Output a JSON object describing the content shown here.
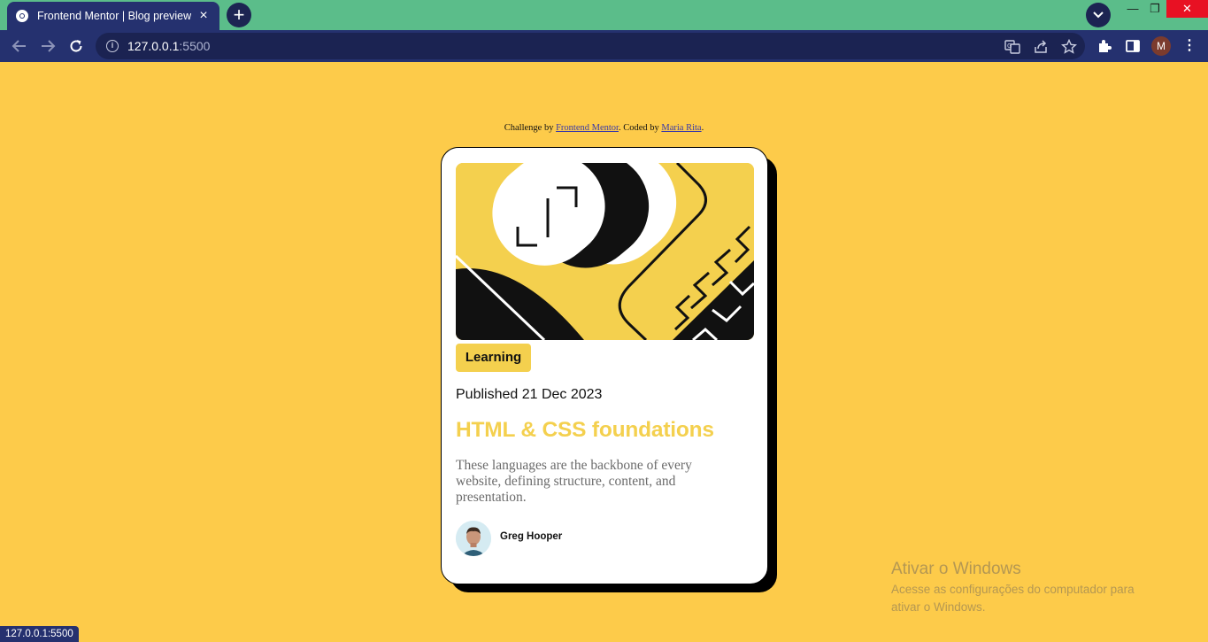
{
  "browser": {
    "tab_title": "Frontend Mentor | Blog preview card",
    "new_tab_label": "+",
    "url_host": "127.0.0.1",
    "url_port": ":5500",
    "profile_initial": "M",
    "status_url": "127.0.0.1:5500",
    "window_controls": {
      "minimize": "—",
      "maximize": "❐",
      "close": "✕"
    }
  },
  "attribution": {
    "prefix": "Challenge by ",
    "link1": "Frontend Mentor",
    "middle": ". Coded by ",
    "link2": "Maria Rita",
    "suffix": "."
  },
  "card": {
    "tag": "Learning",
    "published": "Published 21 Dec 2023",
    "title": "HTML & CSS foundations",
    "excerpt": "These languages are the backbone of every website, defining structure, content, and presentation.",
    "author": "Greg Hooper"
  },
  "watermark": {
    "title": "Ativar o Windows",
    "subtitle": "Acesse as configurações do computador para ativar o Windows."
  },
  "colors": {
    "page_background": "#fdcb4a",
    "accent_yellow": "#f4d04e",
    "browser_frame": "#25316f",
    "tab_strip": "#5bbd8a"
  }
}
